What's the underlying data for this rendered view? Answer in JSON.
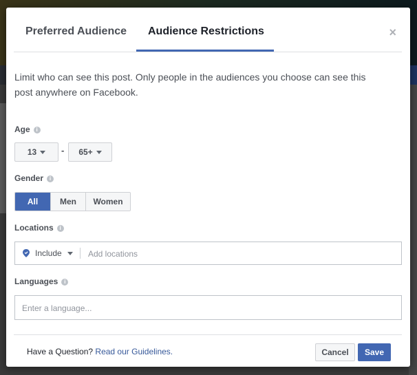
{
  "dialog": {
    "tabs": [
      {
        "label": "Preferred Audience",
        "active": false
      },
      {
        "label": "Audience Restrictions",
        "active": true
      }
    ],
    "close_icon": "×",
    "description": "Limit who can see this post. Only people in the audiences you choose can see this post anywhere on Facebook.",
    "age": {
      "label": "Age",
      "min": "13",
      "separator": "-",
      "max": "65+"
    },
    "gender": {
      "label": "Gender",
      "options": [
        "All",
        "Men",
        "Women"
      ],
      "selected": "All"
    },
    "locations": {
      "label": "Locations",
      "mode": "Include",
      "placeholder": "Add locations"
    },
    "languages": {
      "label": "Languages",
      "placeholder": "Enter a language..."
    },
    "footer": {
      "question": "Have a Question?",
      "link": "Read our Guidelines.",
      "cancel_label": "Cancel",
      "save_label": "Save"
    },
    "info_icon": "i"
  },
  "colors": {
    "accent": "#4267b2",
    "link": "#365899"
  }
}
